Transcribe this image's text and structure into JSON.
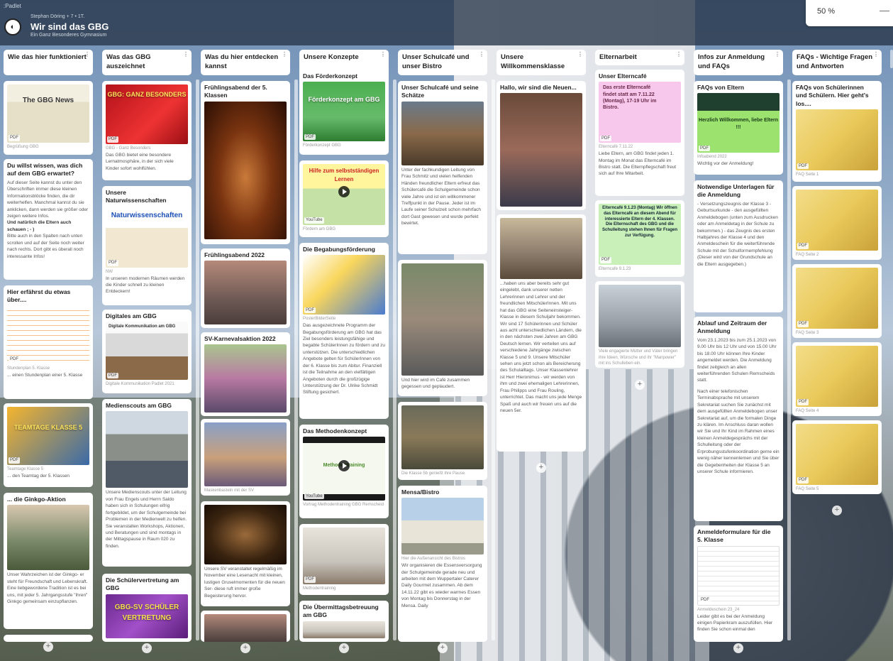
{
  "app": {
    "brand": ":Padlet",
    "author": "Stephan Döring + 7 • 1T.",
    "title": "Wir sind das GBG",
    "subtitle": "Ein Ganz Besonderes Gymnasium",
    "zoom": "50 %",
    "zoom_minus": "—"
  },
  "columns": [
    {
      "title": "Wie das hier funktioniert"
    },
    {
      "title": "Was das GBG auszeichnet"
    },
    {
      "title": "Was du hier entdecken kannst"
    },
    {
      "title": "Unsere Konzepte"
    },
    {
      "title": "Unser Schulcafé und unser Bistro"
    },
    {
      "title": "Unsere Willkommensklasse"
    },
    {
      "title": "Elternarbeit"
    },
    {
      "title": "Infos zur Anmeldung und FAQs"
    },
    {
      "title": "FAQs - Wichtige Fragen und Antworten"
    }
  ],
  "cards": {
    "c1_1": {
      "tag": "PDF",
      "cap": "Begrüßung GBG",
      "thumb": "The GBG News"
    },
    "c1_2": {
      "title": "Du willst wissen, was dich auf dem GBG erwartet?",
      "body": "Auf dieser Seite kannst du unter den Überschriften immer diese kleinen Informationsblöcke finden, die dir weiterhelfen. Manchmal kannst du sie anklicken, dann werden sie größer oder zeigen weitere Infos.",
      "bold": "Und natürlich die Eltern auch schauen ; - )",
      "body2": "Bitte auch in den Spalten nach unten scrollen und auf der Seite noch weiter nach rechts. Dort gibt es überall noch interessante Infos!"
    },
    "c1_3": {
      "title": "Hier erfährst du etwas über....",
      "tag": "PDF",
      "cap": "Stundenplan 5. Klasse",
      "body": "... einen Stundenplan einer 5. Klasse"
    },
    "c1_4": {
      "tag": "PDF",
      "cap": "Teamtage Klasse 5",
      "body": "... den Teamtag der 5. Klassen",
      "thumb": "TEAMTAGE KLASSE 5"
    },
    "c1_5": {
      "title": "... die Ginkgo-Aktion",
      "body": "Unser Wahrzeichen ist der Ginkgo- er steht für Freundschaft und Lebenskraft. Eine liebgewordene Tradition ist es bei uns, mit jeder 5. Jahrgangsstufe \"ihren\" Ginkgo gemeinsam einzupflanzen."
    },
    "c2_1": {
      "tag": "PDF",
      "cap": "GBG - Ganz Besonders",
      "body": "Das GBG bietet eine besondere Lernatmosphäre, in der sich viele Kinder sofort wohlfühlen.",
      "thumb": "GBG: GANZ BESONDERS"
    },
    "c2_2": {
      "title": "Unsere Naturwissenschaften",
      "tag": "PDF",
      "cap": "NW",
      "body": "In unseren modernen Räumen werden die Kinder schnell zu kleinen Entdeckern!",
      "thumb": "Naturwissenschaften"
    },
    "c2_3": {
      "title": "Digitales am GBG",
      "tag": "PDF",
      "cap": "Digitale Kommunikation Padlet 2021",
      "thumb": "Digitale Kommunikation am GBG"
    },
    "c2_4": {
      "title": "Medienscouts am GBG",
      "body": "Unsere Medienscouts unter der Leitung von Frau Engels und Herrn Saldo haben sich in Schulungen eifrig fortgebildet, um der Schulgemeinde bei Problemen in der Medienwelt zu helfen. Sie veranstalten Workshops, Aktionen, und Beratungen und sind montags in der Mittagspause in Raum 020 zu finden."
    },
    "c2_5": {
      "title": "Die Schülervertretung am GBG",
      "thumb": "GBG-SV SCHÜLER VERTRETUNG"
    },
    "c3_1": {
      "title": "Frühlingsabend der 5. Klassen"
    },
    "c3_2": {
      "title": "Frühlingsabend 2022"
    },
    "c3_3": {
      "title": "SV-Karnevalsaktion 2022",
      "cap": "Maskenbasteln mit der SV"
    },
    "c3_4": {
      "body": "Unsere SV veranstaltet regelmäßig im November eine Lesenacht mit kleinen, lustigen Gruselmomenten für die neuen Ser- diese ruft immer große Begeisterung hervor."
    },
    "c4_1": {
      "title": "Das Förderkonzept",
      "tag": "PDF",
      "cap": "Förderkonzept GBG",
      "thumb": "Förderkonzept am GBG"
    },
    "c4_2": {
      "tag": "YouTube",
      "cap": "Fördern am GBG",
      "thumb": "Hilfe zum selbstständigen Lernen"
    },
    "c4_3": {
      "title": "Die Begabungsförderung",
      "tag": "PDF",
      "cap": "PosterBilderSeite",
      "body": "Das ausgezeichnete Programm der Begabungsförderung am GBG hat das Ziel besonders leistungsfähige und begabte SchülerInnen zu fördern und zu unterstützen. Die unterschiedlichen Angebote gelten für SchülerInnen von der 6. Klasse bis zum Abitur. Finanziell ist die Teilnahme an den vielfältigen Angeboten durch die großzügige Unterstützung der Dr. Ulrike Schmidt Stiftung gesichert."
    },
    "c4_4": {
      "title": "Das Methodenkonzept",
      "tag": "YouTube",
      "cap": "Vortrag Methodentraining GBG Remscheid",
      "thumb": "Methodentraining"
    },
    "c4_5": {
      "tag": "PDF",
      "cap": "Methodentraining"
    },
    "c4_6": {
      "title": "Die Übermittagsbetreuung am GBG"
    },
    "c5_1": {
      "title": "Unser Schulcafé und seine Schätze",
      "body": "Unter der fachkundigen Leitung von Frau Schmitz und vielen helfenden Händen freundlicher Eltern erfreut das Schülercafé die Schulgemeinde schon viele Jahre und ist ein willkommener Treffpunkt in der Pause. Jeder ist im Laufe seiner Schulzeit schon mehrfach dort Gast gewesen und wurde perfekt bewirtet."
    },
    "c5_2": {
      "body": "Und hier wird im Café zusammen gegessen und geplaudert."
    },
    "c5_3": {
      "cap": "Die Klasse 5b genießt ihre Pause."
    },
    "c5_4": {
      "title": "Mensa/Bistro",
      "cap": "Hier die Außenansicht des Bistros",
      "body": "Wir organisieren die Essensversorgung der Schulgemeinde gerade neu und arbeiten mit dem Wuppertaler Caterer Daily Gourmet zusammen. Ab dem 14.11.22 gibt es wieder warmes Essen von Montag bis Donnerstag in der Mensa. Daily"
    },
    "c6_1": {
      "title": "Hallo, wir sind die Neuen..."
    },
    "c6_2": {
      "body": "...haben uns aber bereits sehr gut eingelebt, dank unserer netten Lehrerinnen und Lehrer und der freundlichen MitschülerInnen. Mit uns hat das GBG eine Seiteneinsteiger-Klasse in diesem Schuljahr bekommen. Wir sind 17 Schülerinnen und Schüler aus acht unterschiedlichen Ländern, die in den nächsten zwei Jahren am GBG Deutsch lernen. Wir verteilen uns auf verschiedene Jahrgänge zwischen Klasse 5 und 9. Unsere Mitschüler sehen uns jetzt schon als Bereicherung des Schulalltags. Unser Klassenlehrer ist Herr Hieronimus - wir werden von ihm und zwei ehemaligen Lehrerinnen, Frau Philipps und Frau Rouling, unterrichtet. Das macht uns jede Menge Spaß und auch wir freuen uns auf die neuen 5er."
    },
    "c7_1": {
      "title": "Unser Elterncafé",
      "tag": "PDF",
      "cap": "Elterncafé 7.11.22",
      "body": "Liebe Eltern, am GBG findet jeden 1. Montag im Monat das Elterncafé im Bistro statt. Die Elternpflegschaft freut sich auf Ihre Mitarbeit.",
      "thumb": "Das erste Elterncafé findet statt am 7.11.22 (Montag), 17-19 Uhr im Bistro."
    },
    "c7_2": {
      "tag": "PDF",
      "cap": "Elterncafe 9.1.23",
      "thumb": "Elterncafé 9.1.23 (Montag) Wir öffnen das Elterncafé an diesem Abend für interessierte Eltern der 4. Klassen. Die Elternschaft des GBG und die Schulleitung stehen Ihnen für Fragen zur Verfügung."
    },
    "c7_3": {
      "cap": "Viele engagierte Mütter und Väter bringen ihre Ideen, Wünsche und ihr \"Manpower\" mit ins Schulleben ein."
    },
    "c8_1": {
      "title": "FAQs von Eltern",
      "tag": "PDF",
      "cap": "Infoabend 2022",
      "body": "Wichtig vor der Anmeldung!",
      "thumb": "Herzlich Willkommen, liebe Eltern !!!"
    },
    "c8_2": {
      "title": "Notwendige Unterlagen für die Anmeldung",
      "body": "- Versetzungszeugnis der Klasse 3 - Geburtsurkunde - den ausgefüllten Anmeldebogen (unten zum Ausdrucken oder am Anmeldetag in der Schule zu bekommen.) - das Zeugnis des ersten Halbjahres der Klasse 4 und den Anmeldeschein für die weiterführende Schule mit der Schulformempfehlung (Dieser wird von der Grundschule an die Eltern ausgegeben.)"
    },
    "c8_3": {
      "title": "Ablauf und Zeitraum der Anmeldung",
      "body": "Vom 23.1.2023 bis zum 25.1.2023 von 9.00 Uhr bis 12 Uhr und von 15.00 Uhr bis 18.00 Uhr können Ihre Kinder angemeldet werden. Die Anmeldung findet zeitgleich an allen weiterführenden Schulen Remscheids statt.",
      "body2": "Nach einer telefonischen Terminabsprache mit unserem Sekretariat suchen Sie zunächst mit dem ausgefüllten Anmeldebogen unser Sekretariat auf, um die formalen Dinge zu klären. Im Anschluss daran wollen wir Sie und Ihr Kind im Rahmen eines kleinen Anmeldegesprächs mit der Schulleitung oder der Erprobungsstufenkoordination gerne ein wenig näher kennenlernen und Sie über die Gegebenheiten der Klasse 5 an unserer Schule informieren."
    },
    "c8_4": {
      "title": "Anmeldeformulare für die 5. Klasse",
      "tag": "PDF",
      "cap": "Anmeldeschein 23_24",
      "body": "Leider gibt es bei der Anmeldung einigen Papierkram auszufüllen. Hier finden Sie schon einmal den"
    },
    "c9_1": {
      "title": "FAQs von Schülerinnen und Schülern. Hier geht's los....",
      "tag": "PDF",
      "cap": "FAQ Seite 1"
    },
    "c9_2": {
      "tag": "PDF",
      "cap": "FAQ Seite 2"
    },
    "c9_3": {
      "tag": "PDF",
      "cap": "FAQ Seite 3"
    },
    "c9_4": {
      "tag": "PDF",
      "cap": "FAQ Seite 4"
    },
    "c9_5": {
      "tag": "PDF",
      "cap": "FAQ Seite 5"
    }
  },
  "icons": {
    "add": "+",
    "more": "⋮"
  }
}
